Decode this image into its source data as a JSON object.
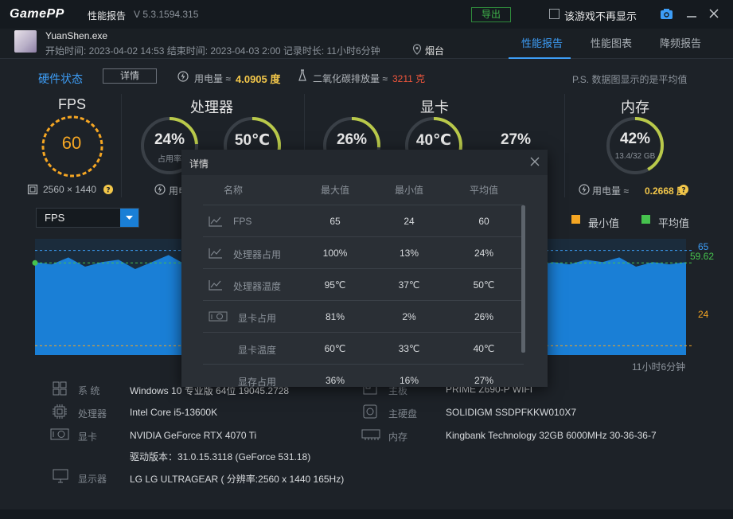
{
  "titlebar": {
    "logo": "GamePP",
    "title": "性能报告",
    "version": "V 5.3.1594.315",
    "export": "导出",
    "hide_label": "该游戏不再显示"
  },
  "session": {
    "exe": "YuanShen.exe",
    "times": "开始时间: 2023-04-02 14:53    结束时间: 2023-04-03 2:00    记录时长: 11小时6分钟",
    "location": "烟台"
  },
  "tabs": [
    "性能报告",
    "性能图表",
    "降频报告"
  ],
  "hardware": {
    "status": "硬件状态",
    "detail": "详情",
    "power_label": "用电量 ≈",
    "power_val": "4.0905 度",
    "co2_label": "二氧化碳排放量 ≈",
    "co2_val": "3211 克",
    "ps": "P.S. 数据图显示的是平均值"
  },
  "sections": {
    "fps": "FPS",
    "cpu": "处理器",
    "gpu": "显卡",
    "mem": "内存"
  },
  "gauges": {
    "fps": {
      "value": "60",
      "resolution": "2560 × 1440"
    },
    "cpu_usage": {
      "value": "24%",
      "sub": "占用率",
      "level": 0.24
    },
    "cpu_temp": {
      "value": "50℃",
      "level": 0.5
    },
    "gpu_usage": {
      "value": "26%",
      "level": 0.26
    },
    "gpu_temp": {
      "value": "40℃",
      "level": 0.4
    },
    "gpu_mem": {
      "value": "27%",
      "level": 0.27
    },
    "mem": {
      "value": "42%",
      "sub": "13.4/32 GB",
      "level": 0.42,
      "power_label": "用电量 ≈",
      "power_val": "0.2668 度"
    },
    "cpu_power_label": "用电"
  },
  "chart_panel": {
    "select": "FPS",
    "legend_min": "最小值",
    "legend_avg": "平均值",
    "max_label": "65",
    "avg_label": "59.62",
    "min_label": "24",
    "duration": "11小时6分钟"
  },
  "chart_data": {
    "type": "area",
    "series": [
      {
        "name": "FPS",
        "values": [
          60,
          59,
          62,
          58,
          60,
          61,
          57,
          60,
          63,
          59,
          60,
          58,
          61,
          60,
          59,
          60,
          62,
          60,
          57,
          60,
          61,
          59,
          60,
          58,
          60,
          62,
          59,
          60,
          61,
          60,
          58,
          60,
          59,
          61,
          60,
          62,
          58,
          60,
          59,
          60
        ]
      }
    ],
    "max": 65,
    "min": 24,
    "avg": 59.62,
    "ylim": [
      20,
      70
    ]
  },
  "system": [
    {
      "label": "系 统",
      "value": "Windows 10 专业版 64位 19045.2728",
      "icon": "windows-icon"
    },
    {
      "label": "主板",
      "value": "PRIME Z690-P WIFI",
      "icon": "motherboard-icon"
    },
    {
      "label": "处理器",
      "value": "Intel Core i5-13600K",
      "icon": "cpu-icon"
    },
    {
      "label": "主硬盘",
      "value": "SOLIDIGM SSDPFKKW010X7",
      "icon": "disk-icon"
    },
    {
      "label": "显卡",
      "value": "NVIDIA GeForce RTX 4070 Ti",
      "icon": "gpu-icon"
    },
    {
      "label": "内存",
      "value": "Kingbank Technology 32GB 6000MHz 30-36-36-7",
      "icon": "ram-icon"
    },
    {
      "label": "",
      "value": "驱动版本：31.0.15.3118 (GeForce 531.18)",
      "icon": ""
    },
    {
      "label": "显示器",
      "value": "LG LG ULTRAGEAR ( 分辨率:2560 x 1440 165Hz)",
      "icon": "monitor-icon"
    }
  ],
  "modal": {
    "title": "详情",
    "headers": [
      "名称",
      "最大值",
      "最小值",
      "平均值"
    ],
    "rows": [
      {
        "name": "FPS",
        "max": "65",
        "min": "24",
        "avg": "60",
        "icon": "chart-icon"
      },
      {
        "name": "处理器占用",
        "max": "100%",
        "min": "13%",
        "avg": "24%",
        "icon": "chart-icon"
      },
      {
        "name": "处理器温度",
        "max": "95℃",
        "min": "37℃",
        "avg": "50℃",
        "icon": "chart-icon"
      },
      {
        "name": "显卡占用",
        "max": "81%",
        "min": "2%",
        "avg": "26%",
        "icon": "gpu-icon"
      },
      {
        "name": "显卡温度",
        "max": "60℃",
        "min": "33℃",
        "avg": "40℃",
        "icon": ""
      },
      {
        "name": "显存占用",
        "max": "36%",
        "min": "16%",
        "avg": "27%",
        "icon": ""
      }
    ]
  },
  "colors": {
    "accent": "#3d9df6",
    "fps": "#f5a623",
    "avg": "#46c24e",
    "chart": "#1a7fd6"
  }
}
